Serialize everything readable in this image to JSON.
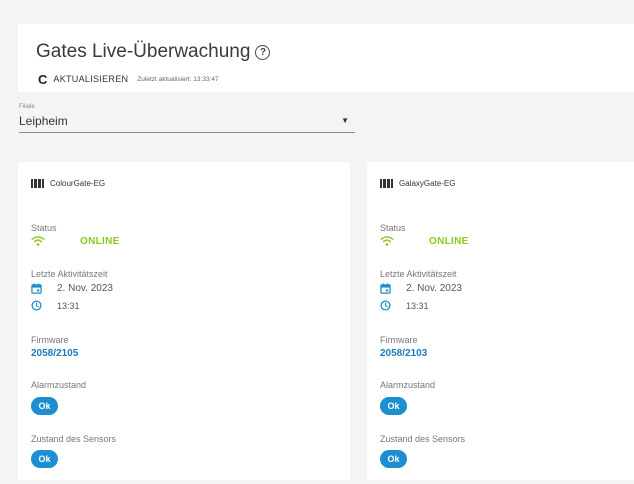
{
  "header": {
    "title": "Gates Live-Überwachung",
    "help_icon": "help-circle-icon",
    "refresh_label": "AKTUALISIEREN",
    "refresh_icon": "refresh-icon",
    "last_updated": "Zuletzt aktualisiert: 13:33:47"
  },
  "filter": {
    "label": "Filiale",
    "value": "Leipheim"
  },
  "labels": {
    "status": "Status",
    "last_activity": "Letzte Aktivitätszeit",
    "firmware": "Firmware",
    "alarm": "Alarmzustand",
    "sensor": "Zustand des Sensors"
  },
  "gates": [
    {
      "name": "ColourGate-EG",
      "status": "ONLINE",
      "date": "2. Nov. 2023",
      "time": "13:31",
      "firmware": "2058/2105",
      "alarm": "Ok",
      "sensor": "Ok"
    },
    {
      "name": "GalaxyGate-EG",
      "status": "ONLINE",
      "date": "2. Nov. 2023",
      "time": "13:31",
      "firmware": "2058/2103",
      "alarm": "Ok",
      "sensor": "Ok"
    }
  ],
  "colors": {
    "online": "#8bc81f",
    "accent": "#1d8ed0",
    "firmware_link": "#1a7bbf"
  }
}
